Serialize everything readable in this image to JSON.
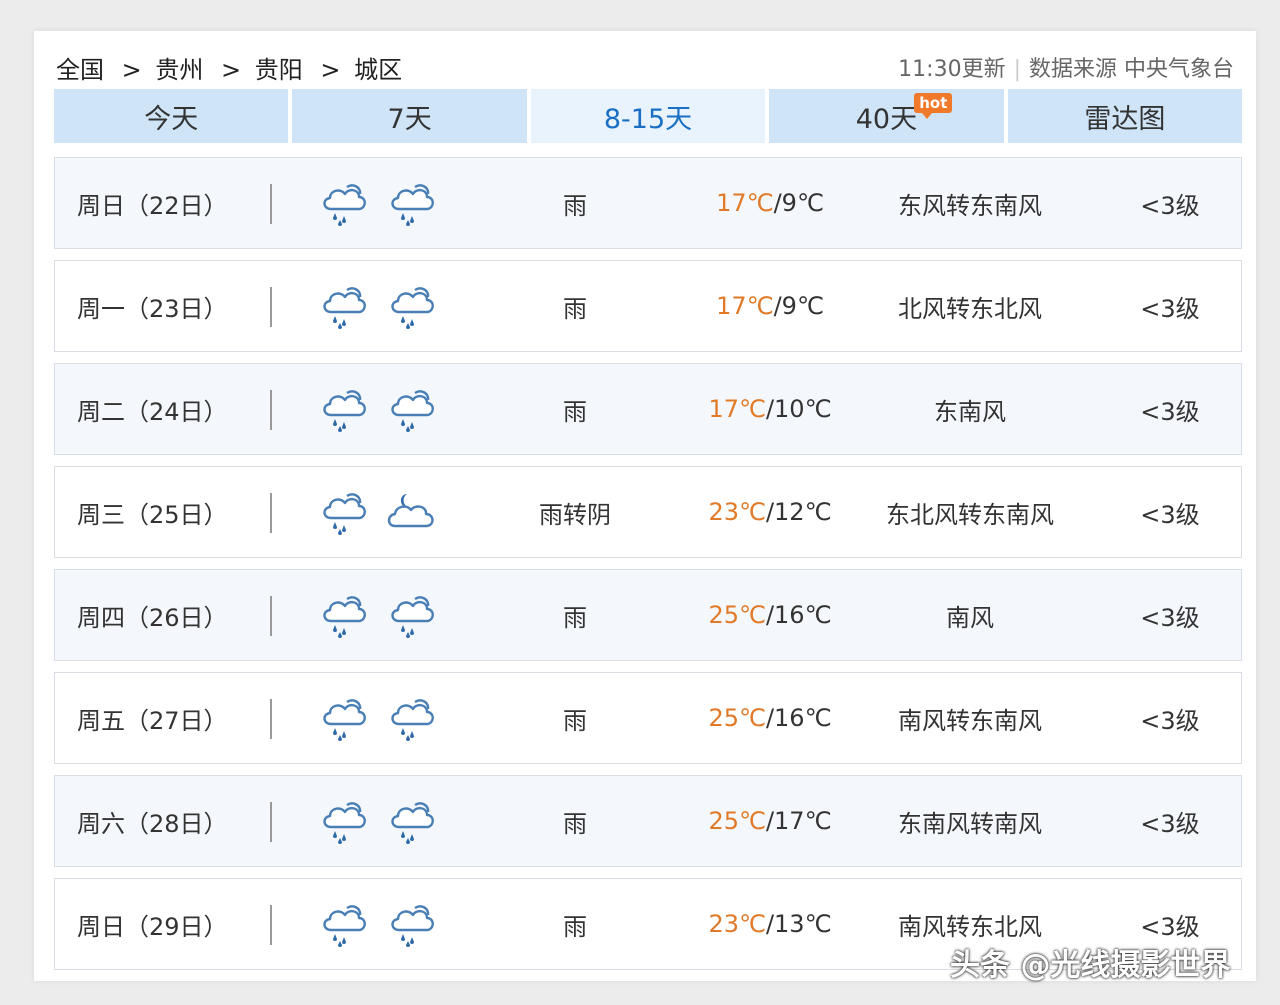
{
  "breadcrumb": {
    "items": [
      "全国",
      "贵州",
      "贵阳",
      "城区"
    ],
    "separator": ">"
  },
  "meta": {
    "update_time": "11:30更新",
    "source": "数据来源 中央气象台"
  },
  "tabs": [
    {
      "label": "今天"
    },
    {
      "label": "7天"
    },
    {
      "label": "8-15天",
      "active": true
    },
    {
      "label": "40天",
      "badge": "hot"
    },
    {
      "label": "雷达图"
    }
  ],
  "colors": {
    "accent": "#1a6fc4",
    "high_temp": "#e07a28",
    "tab_bg": "#cfe4f7",
    "hot_badge": "#f0792a"
  },
  "forecast": [
    {
      "day": "周日（22日）",
      "icon1": "rain-cloud-icon",
      "icon2": "rain-cloud-icon",
      "weather": "雨",
      "high": "17℃",
      "low": "/9℃",
      "wind": "东风转东南风",
      "level": "<3级"
    },
    {
      "day": "周一（23日）",
      "icon1": "rain-cloud-icon",
      "icon2": "rain-cloud-icon",
      "weather": "雨",
      "high": "17℃",
      "low": "/9℃",
      "wind": "北风转东北风",
      "level": "<3级"
    },
    {
      "day": "周二（24日）",
      "icon1": "rain-cloud-icon",
      "icon2": "rain-cloud-icon",
      "weather": "雨",
      "high": "17℃",
      "low": "/10℃",
      "wind": "东南风",
      "level": "<3级"
    },
    {
      "day": "周三（25日）",
      "icon1": "rain-cloud-icon",
      "icon2": "moon-cloud-icon",
      "weather": "雨转阴",
      "high": "23℃",
      "low": "/12℃",
      "wind": "东北风转东南风",
      "level": "<3级"
    },
    {
      "day": "周四（26日）",
      "icon1": "rain-cloud-icon",
      "icon2": "rain-cloud-icon",
      "weather": "雨",
      "high": "25℃",
      "low": "/16℃",
      "wind": "南风",
      "level": "<3级"
    },
    {
      "day": "周五（27日）",
      "icon1": "rain-cloud-icon",
      "icon2": "rain-cloud-icon",
      "weather": "雨",
      "high": "25℃",
      "low": "/16℃",
      "wind": "南风转东南风",
      "level": "<3级"
    },
    {
      "day": "周六（28日）",
      "icon1": "rain-cloud-icon",
      "icon2": "rain-cloud-icon",
      "weather": "雨",
      "high": "25℃",
      "low": "/17℃",
      "wind": "东南风转南风",
      "level": "<3级"
    },
    {
      "day": "周日（29日）",
      "icon1": "rain-cloud-icon",
      "icon2": "rain-cloud-icon",
      "weather": "雨",
      "high": "23℃",
      "low": "/13℃",
      "wind": "南风转东北风",
      "level": "<3级"
    }
  ],
  "watermark": "头条 @光线摄影世界"
}
